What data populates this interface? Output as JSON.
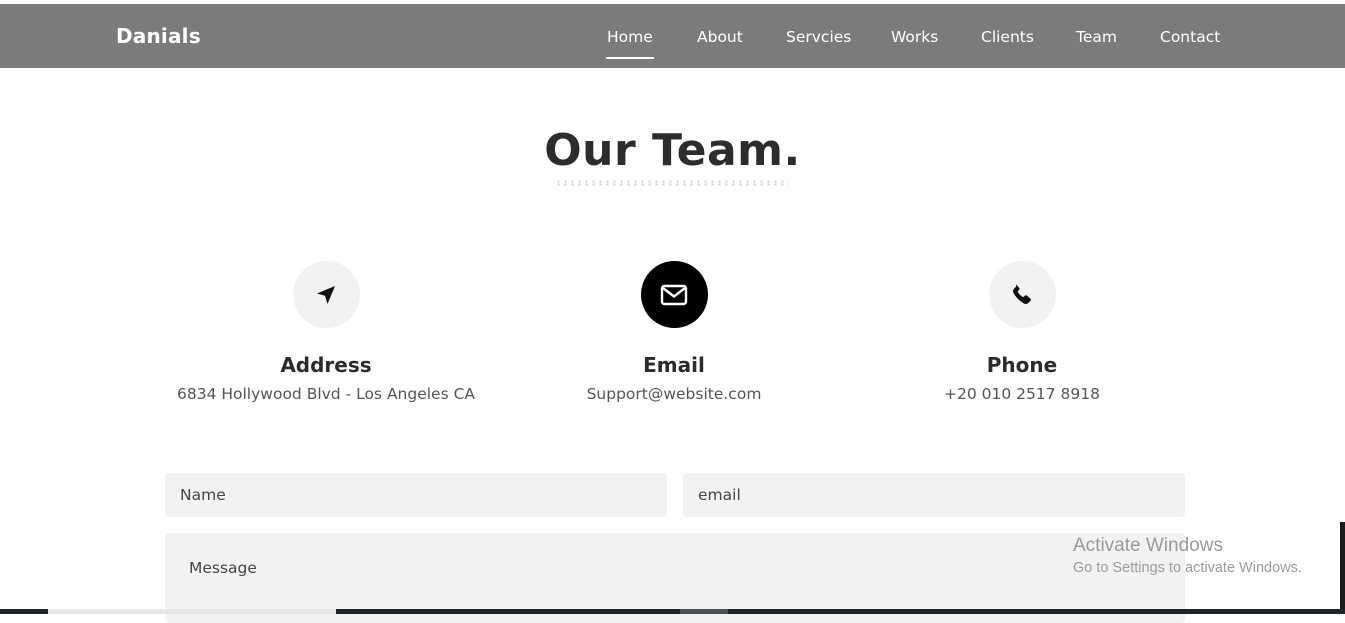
{
  "brand": "Danials",
  "nav": {
    "items": [
      "Home",
      "About",
      "Servcies",
      "Works",
      "Clients",
      "Team",
      "Contact"
    ],
    "active": "Home"
  },
  "section": {
    "title": "Our Team."
  },
  "contact_info": [
    {
      "icon": "location-arrow-icon",
      "title": "Address",
      "value": "6834 Hollywood Blvd - Los Angeles CA"
    },
    {
      "icon": "envelope-icon",
      "title": "Email",
      "value": "Support@website.com"
    },
    {
      "icon": "phone-icon",
      "title": "Phone",
      "value": "+20 010 2517 8918"
    }
  ],
  "form": {
    "name_placeholder": "Name",
    "email_placeholder": "email",
    "message_placeholder": "Message"
  },
  "watermark": {
    "line1": "Activate Windows",
    "line2": "Go to Settings to activate Windows."
  },
  "colors": {
    "navbar": "#7b7b7b",
    "accent": "#000000",
    "field_bg": "#f2f2f2",
    "icon_bg": "#f2f2f2"
  }
}
